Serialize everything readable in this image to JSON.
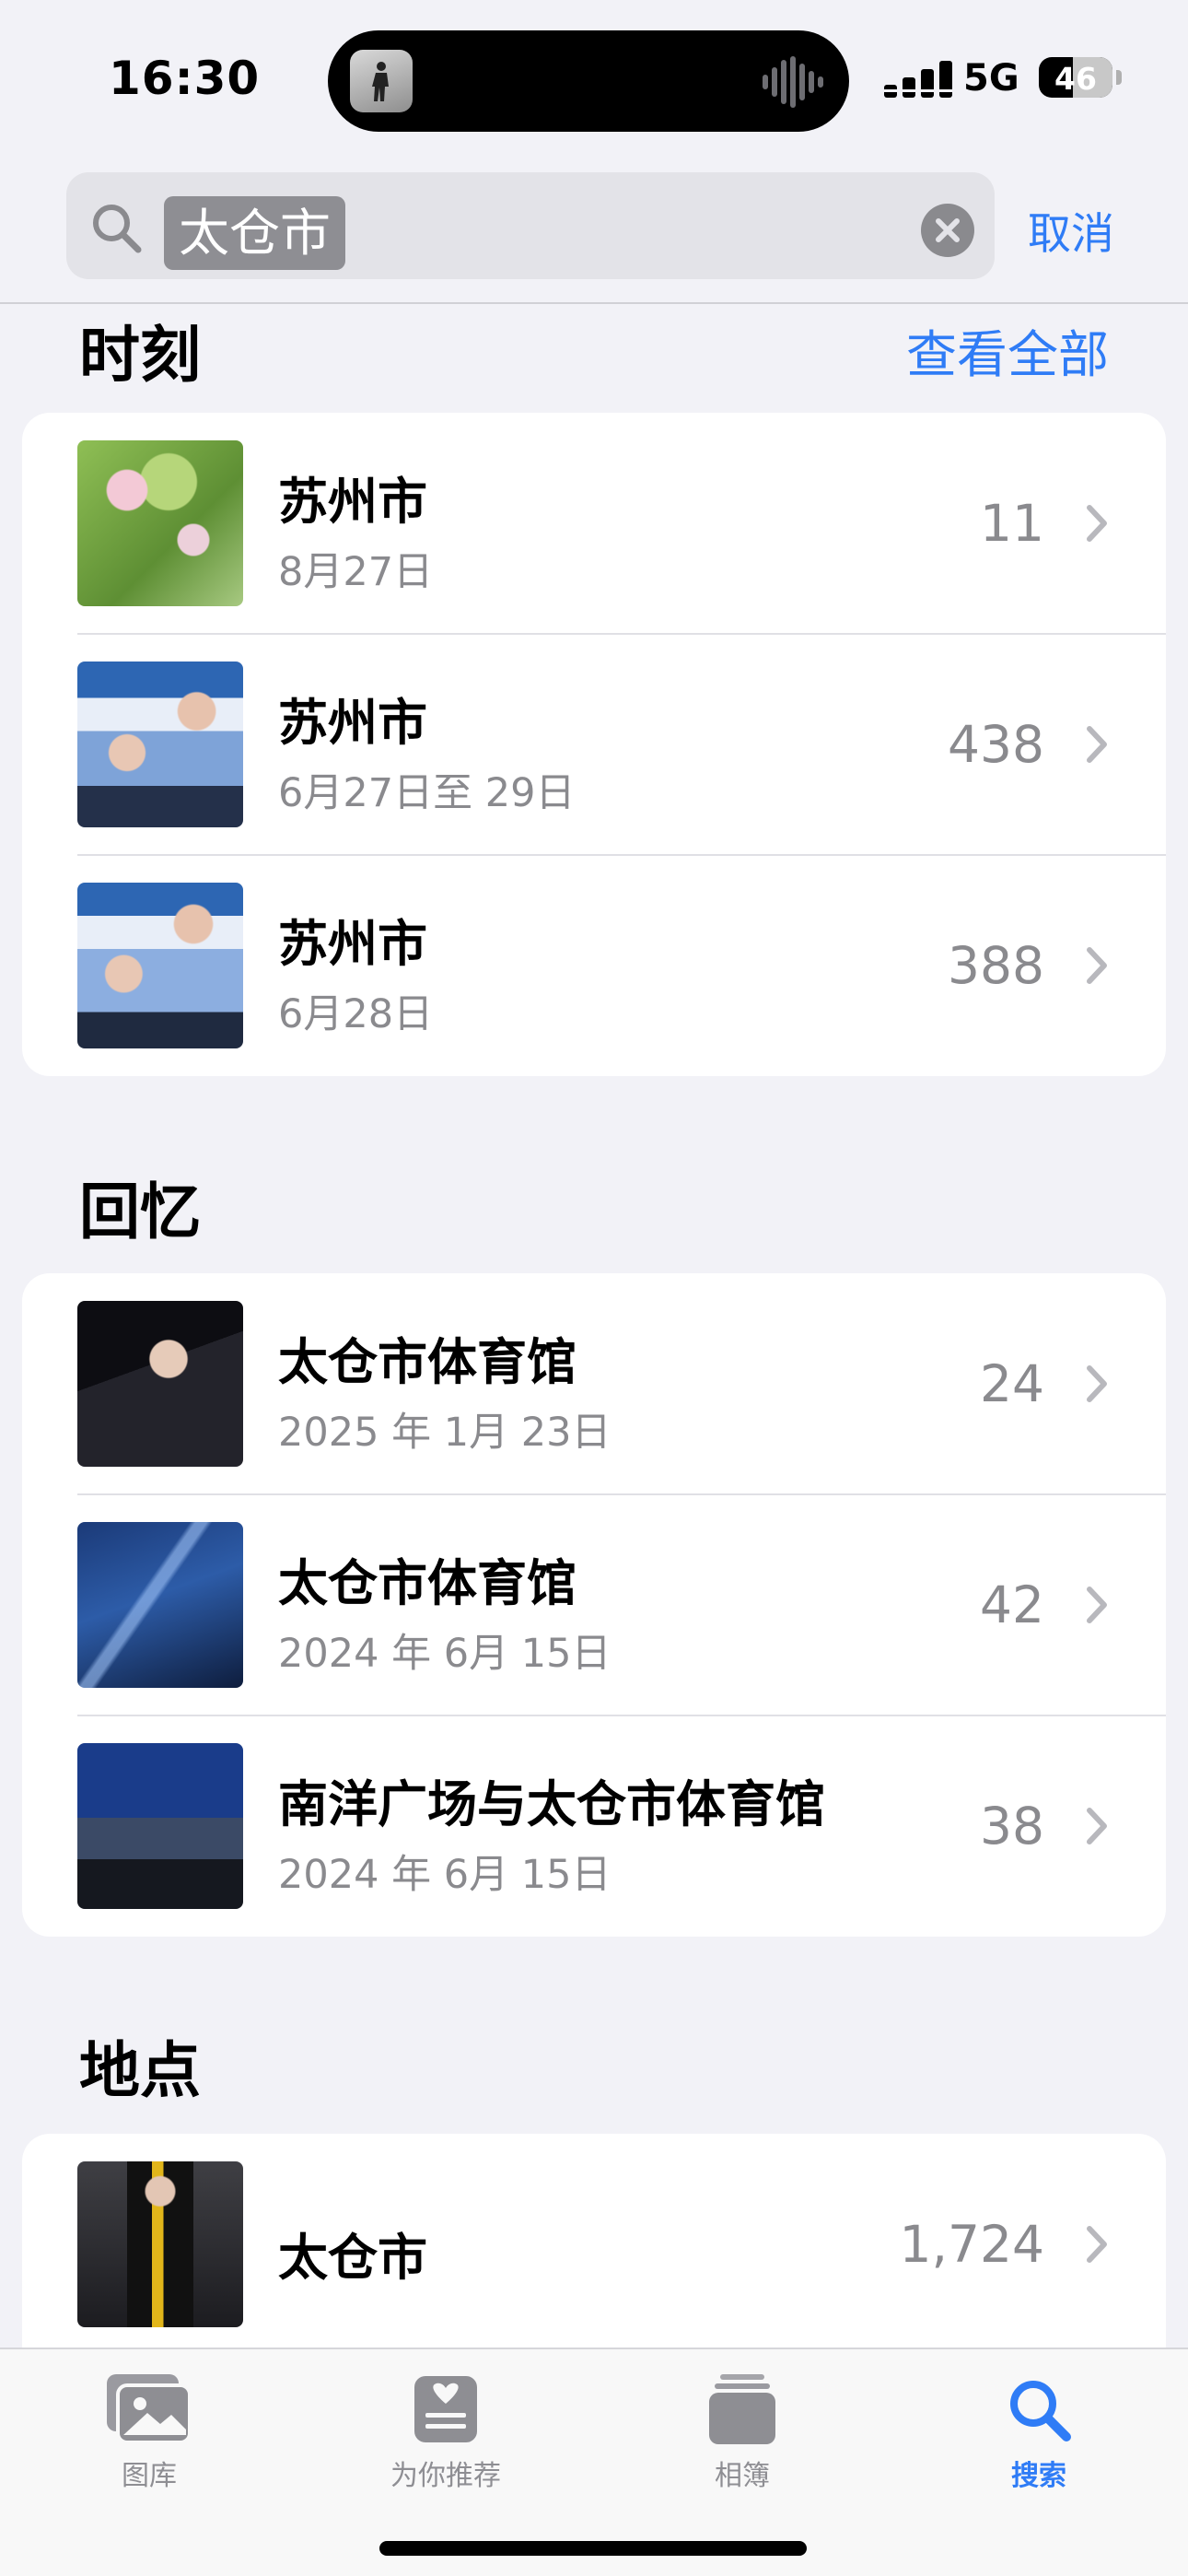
{
  "status_bar": {
    "time": "16:30",
    "network": "5G",
    "battery": "46",
    "battery_level": 0.46
  },
  "search": {
    "token": "太仓市",
    "cancel_label": "取消"
  },
  "moments": {
    "title": "时刻",
    "see_all_label": "查看全部",
    "rows": [
      {
        "title": "苏州市",
        "subtitle": "8月27日",
        "count": "11"
      },
      {
        "title": "苏州市",
        "subtitle": "6月27日至 29日",
        "count": "438"
      },
      {
        "title": "苏州市",
        "subtitle": "6月28日",
        "count": "388"
      }
    ]
  },
  "memories": {
    "title": "回忆",
    "rows": [
      {
        "title": "太仓市体育馆",
        "subtitle": "2025 年 1月 23日",
        "count": "24"
      },
      {
        "title": "太仓市体育馆",
        "subtitle": "2024 年 6月 15日",
        "count": "42"
      },
      {
        "title": "南洋广场与太仓市体育馆",
        "subtitle": "2024 年 6月 15日",
        "count": "38"
      }
    ]
  },
  "places": {
    "title": "地点",
    "rows": [
      {
        "title": "太仓市",
        "count": "1,724"
      }
    ]
  },
  "tab_bar": {
    "tabs": [
      {
        "label": "图库",
        "icon": "photo-library-icon"
      },
      {
        "label": "为你推荐",
        "icon": "for-you-icon"
      },
      {
        "label": "相簿",
        "icon": "albums-icon"
      },
      {
        "label": "搜索",
        "icon": "search-icon",
        "active": true
      }
    ]
  },
  "colors": {
    "accent": "#2f7cf6",
    "secondary_text": "#8a8a8e",
    "background": "#f2f2f7"
  }
}
